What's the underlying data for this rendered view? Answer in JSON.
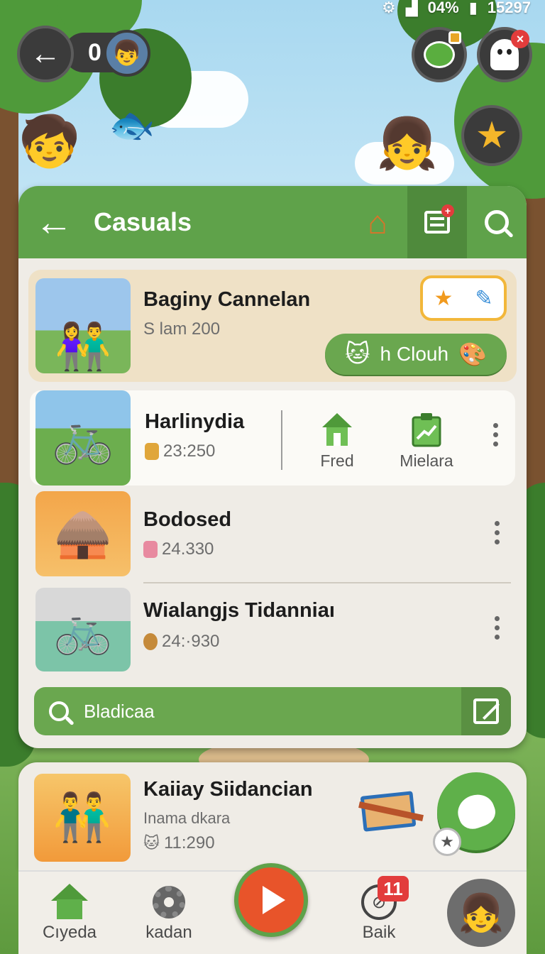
{
  "status_bar": {
    "battery": "04%",
    "time": "15297"
  },
  "hud": {
    "score": "0"
  },
  "panel": {
    "title": "Casuals"
  },
  "items": [
    {
      "title": "Baginy Cannelan",
      "subtitle": "S lam 200",
      "action_label": "h Clouh"
    },
    {
      "title": "Harlinydia",
      "subtitle": "23:250",
      "actions": [
        {
          "label": "Fred"
        },
        {
          "label": "Mielara"
        }
      ]
    },
    {
      "title": "Bodosed",
      "subtitle": "24.330"
    },
    {
      "title": "Wialangjs Tidanniaı",
      "subtitle": "24:·930"
    }
  ],
  "search": {
    "text": "Bladicaa"
  },
  "bottom_card": {
    "title": "Kaiiay Siidancian",
    "subtitle": "Inama dkara",
    "value": "11:290"
  },
  "nav": {
    "items": [
      {
        "label": "Cıyeda"
      },
      {
        "label": "kadan"
      },
      {
        "label": "Baik",
        "badge": "11"
      }
    ]
  },
  "colors": {
    "accent_green": "#5fa24a",
    "play_orange": "#e8542a",
    "badge_red": "#e23c3c",
    "star_gold": "#f4b62a"
  }
}
